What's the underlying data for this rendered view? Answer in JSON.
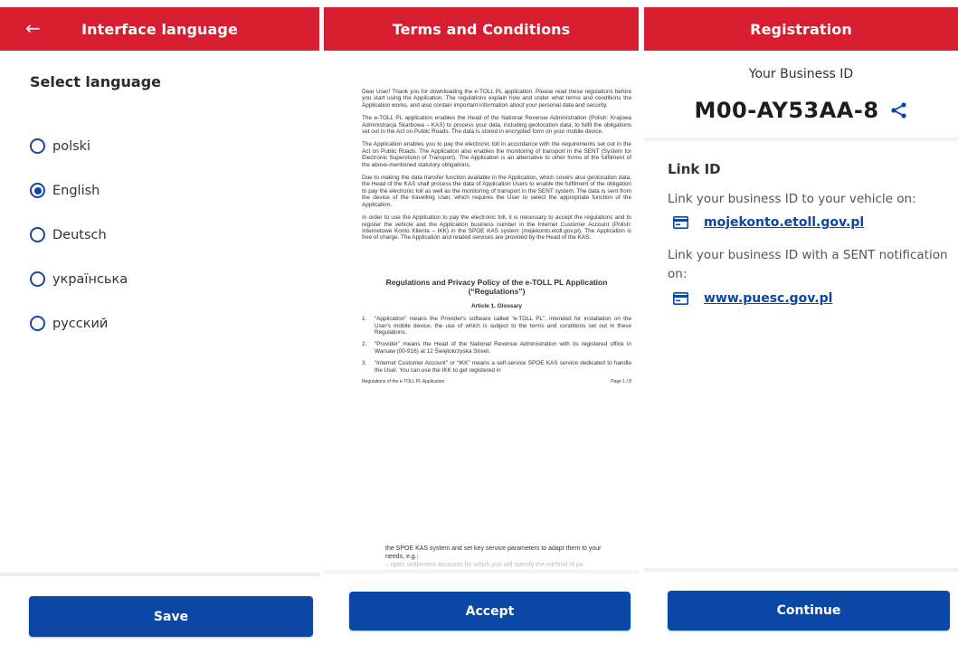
{
  "screen1": {
    "title": "Interface language",
    "heading": "Select language",
    "languages": [
      {
        "label": "polski",
        "selected": false
      },
      {
        "label": "English",
        "selected": true
      },
      {
        "label": "Deutsch",
        "selected": false
      },
      {
        "label": "українська",
        "selected": false
      },
      {
        "label": "русский",
        "selected": false
      }
    ],
    "button": "Save"
  },
  "screen2": {
    "title": "Terms and Conditions",
    "paragraphs": [
      "Dear User! Thank you for downloading the e-TOLL PL application. Please read these regulations before you start using the Application. The regulations explain how and under what terms and conditions the Application works, and also contain important information about your personal data and security.",
      "The e-TOLL PL application enables the Head of the National Revenue Administration (Polish: Krajowa Administracja Skarbowa – KAS) to process your data, including geolocation data, to fulfil the obligations set out in the Act on Public Roads. The data is stored in encrypted form on your mobile device.",
      "The Application enables you to pay the electronic toll in accordance with the requirements set out in the Act on Public Roads. The Application also enables the monitoring of transport in the SENT (System for Electronic Supervision of Transport). The Application is an alternative to other forms of the fulfilment of the above-mentioned statutory obligations.",
      "Due to making the data transfer function available in the Application, which covers also geolocation data, the Head of the KAS shall process the data of Application Users to enable the fulfilment of the obligation to pay the electronic toll as well as the monitoring of transport in the SENT system. The data is sent from the device of the travelling User, which requires the User to select the appropriate function of the Application.",
      "In order to use the Application to pay the electronic toll, it is necessary to accept the regulations and to register the vehicle and the Application business number in the Internet Customer Account (Polish: Internetowe Konto Klienta – IKK) in the SPOE KAS system (mojekonto.etoll.gov.pl). The Application is free of charge. The Application and related services are provided by the Head of the KAS."
    ],
    "doc_title": "Regulations and Privacy Policy of the e-TOLL PL Application (“Regulations”)",
    "article": "Article 1. Glossary",
    "items": [
      {
        "num": "1.",
        "text": "“Application” means the Provider's software called “e-TOLL PL”, intended for installation on the User's mobile device, the use of which is subject to the terms and conditions set out in these Regulations."
      },
      {
        "num": "2.",
        "text": "“Provider” means the Head of the National Revenue Administration with its registered office in Warsaw (00-916) at 12 Świętokrzyska Street."
      },
      {
        "num": "3.",
        "text": "“Internet Customer Account” or “IKK” means a self-service SPOE KAS service dedicated to handle the User. You can use the IKK to get registered in"
      }
    ],
    "footer_left": "Regulations of the e-TOLL PL Application",
    "footer_right": "Page 1 / 8",
    "continuation": "the SPOE KAS system and set key service parameters to adapt them to your needs, e.g.:",
    "continuation_faded": "– open settlement accounts for which you will specify the method of pa",
    "button": "Accept"
  },
  "screen3": {
    "title": "Registration",
    "id_caption": "Your Business ID",
    "business_id": "M00-AY53AA-8",
    "link_title": "Link ID",
    "text1": "Link your business ID to your vehicle on:",
    "link1": "mojekonto.etoll.gov.pl",
    "text2": "Link your business ID with a SENT notification on:",
    "link2": "www.puesc.gov.pl",
    "button": "Continue"
  },
  "colors": {
    "appbar": "#d71d30",
    "primary": "#0b47a5"
  },
  "icons": [
    "back-arrow-icon",
    "radio-icon",
    "share-icon",
    "card-icon"
  ]
}
